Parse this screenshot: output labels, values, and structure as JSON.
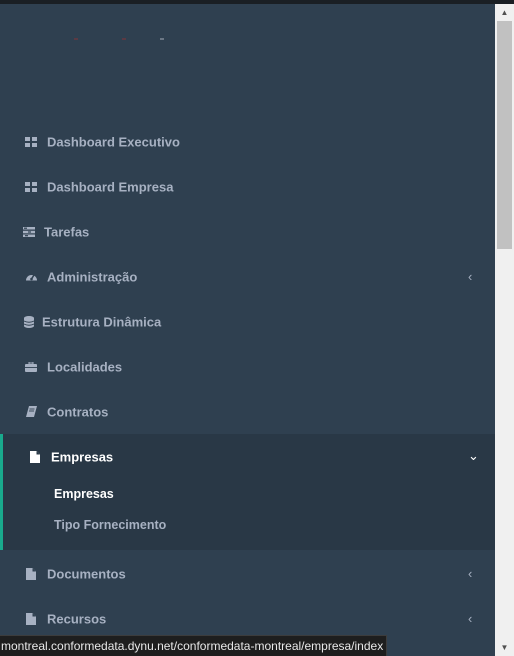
{
  "colors": {
    "sidebar_bg": "#2f4050",
    "active_bg": "#293846",
    "accent": "#19aa8d",
    "text": "#a7b1c2",
    "text_active": "#ffffff"
  },
  "menu": {
    "dashboard_executivo": {
      "label": "Dashboard Executivo",
      "icon": "th-large-icon"
    },
    "dashboard_empresa": {
      "label": "Dashboard Empresa",
      "icon": "th-large-icon"
    },
    "tarefas": {
      "label": "Tarefas",
      "icon": "tasks-icon"
    },
    "administracao": {
      "label": "Administração",
      "icon": "tachometer-icon",
      "chevron": "‹"
    },
    "estrutura_dinamica": {
      "label": "Estrutura Dinâmica",
      "icon": "database-icon"
    },
    "localidades": {
      "label": "Localidades",
      "icon": "briefcase-icon"
    },
    "contratos": {
      "label": "Contratos",
      "icon": "book-icon"
    },
    "empresas": {
      "label": "Empresas",
      "icon": "file-icon",
      "chevron": "⌄",
      "subitems": [
        "Empresas",
        "Tipo Fornecimento"
      ]
    },
    "documentos": {
      "label": "Documentos",
      "icon": "file-icon",
      "chevron": "‹"
    },
    "recursos": {
      "label": "Recursos",
      "icon": "file-icon",
      "chevron": "‹"
    }
  },
  "status_bar": {
    "url": "montreal.conformedata.dynu.net/conformedata-montreal/empresa/index"
  }
}
